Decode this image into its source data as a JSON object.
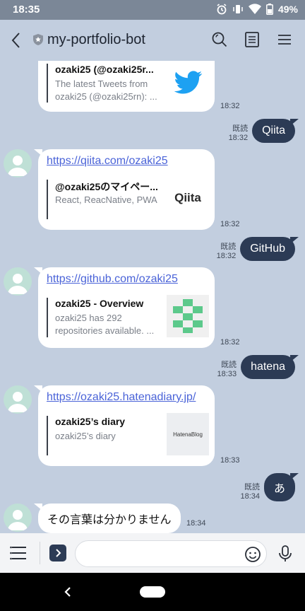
{
  "status": {
    "time": "18:35",
    "battery": "49%"
  },
  "header": {
    "title": "my-portfolio-bot"
  },
  "messages": {
    "twitter": {
      "title": "ozaki25 (@ozaki25r...",
      "desc": "The latest Tweets from ozaki25 (@ozaki25rn): ...",
      "time": "18:32"
    },
    "qiita_sent": {
      "read": "既読",
      "time": "18:32",
      "text": "Qiita"
    },
    "qiita": {
      "link": "https://qiita.com/ozaki25",
      "title": "@ozaki25のマイペー...",
      "desc": "React, ReacNative, PWA",
      "logo": "Qiita",
      "time": "18:32"
    },
    "github_sent": {
      "read": "既読",
      "time": "18:32",
      "text": "GitHub"
    },
    "github": {
      "link": "https://github.com/ozaki25",
      "title": "ozaki25 - Overview",
      "desc": "ozaki25 has 292 repositories available. ...",
      "time": "18:32"
    },
    "hatena_sent": {
      "read": "既読",
      "time": "18:33",
      "text": "hatena"
    },
    "hatena": {
      "link": "https://ozaki25.hatenadiary.jp/",
      "title": "ozaki25’s diary",
      "desc": "ozaki25’s diary",
      "logo": "HatenaBlog",
      "time": "18:33"
    },
    "a_sent": {
      "read": "既読",
      "time": "18:34",
      "text": "あ"
    },
    "reply": {
      "text": "その言葉は分かりません",
      "time": "18:34"
    }
  },
  "input": {
    "placeholder": ""
  },
  "colors": {
    "background": "#c2cedf",
    "sent_bubble": "#2c3b55",
    "link": "#4a63d8"
  },
  "icons": [
    "back-icon",
    "shield-icon",
    "search-icon",
    "notes-icon",
    "menu-icon",
    "rich-menu-icon",
    "chevron-right-icon",
    "emoji-icon",
    "mic-icon"
  ]
}
